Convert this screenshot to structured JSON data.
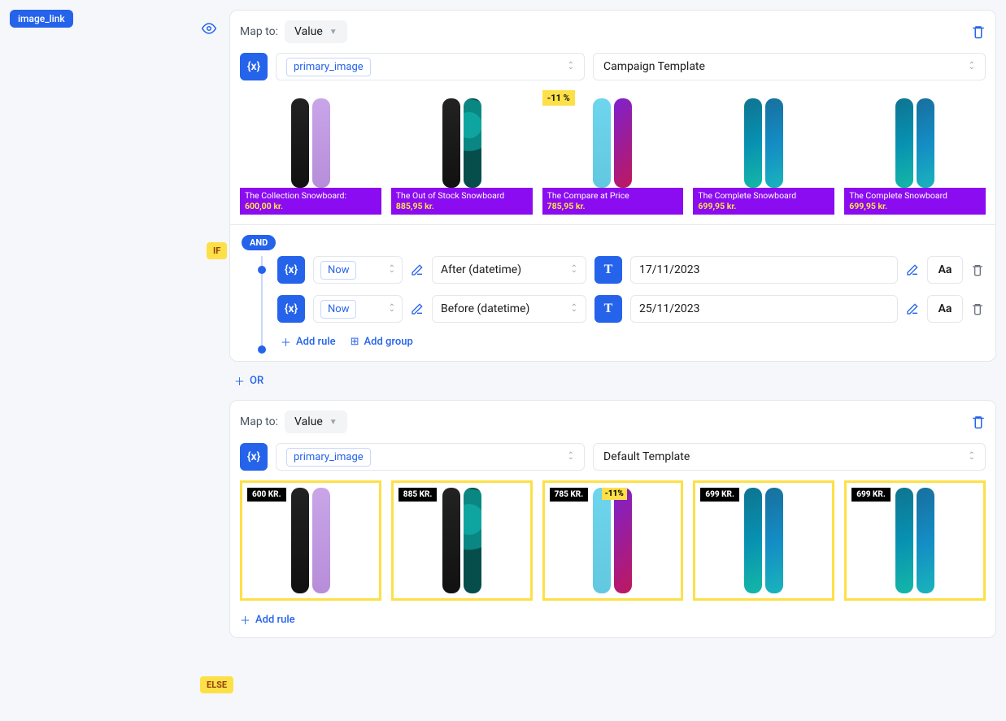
{
  "field_tag": "image_link",
  "branch_labels": {
    "if": "IF",
    "else": "ELSE"
  },
  "panel1": {
    "map_to_label": "Map to:",
    "map_to_value": "Value",
    "variable_token": "primary_image",
    "template": "Campaign Template",
    "thumbs": [
      {
        "title": "The Collection Snowboard:",
        "price": "600,00 kr.",
        "discount": null
      },
      {
        "title": "The Out of Stock Snowboard",
        "price": "885,95 kr.",
        "discount": null
      },
      {
        "title": "The Compare at Price",
        "price": "785,95 kr.",
        "discount": "-11 %"
      },
      {
        "title": "The Complete Snowboard",
        "price": "699,95 kr.",
        "discount": null
      },
      {
        "title": "The Complete Snowboard",
        "price": "699,95 kr.",
        "discount": null
      }
    ],
    "rules": {
      "logic": "AND",
      "rows": [
        {
          "var": "Now",
          "op": "After (datetime)",
          "value": "17/11/2023"
        },
        {
          "var": "Now",
          "op": "Before (datetime)",
          "value": "25/11/2023"
        }
      ],
      "add_rule": "Add rule",
      "add_group": "Add group"
    }
  },
  "between": {
    "or": "OR"
  },
  "panel2": {
    "map_to_label": "Map to:",
    "map_to_value": "Value",
    "variable_token": "primary_image",
    "template": "Default Template",
    "thumbs": [
      {
        "tag": "600 KR.",
        "discount": null
      },
      {
        "tag": "885 KR.",
        "discount": null
      },
      {
        "tag": "785 KR.",
        "discount": "-11%"
      },
      {
        "tag": "699 KR.",
        "discount": null
      },
      {
        "tag": "699 KR.",
        "discount": null
      }
    ],
    "add_rule": "Add rule"
  }
}
